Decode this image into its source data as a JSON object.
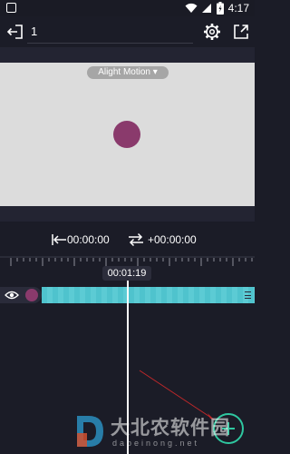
{
  "status_bar": {
    "time": "4:17"
  },
  "toolbar": {
    "project_name": "1"
  },
  "preview": {
    "watermark_label": "Alight Motion ▾",
    "dot_color": "#8a3a6c"
  },
  "timing": {
    "in_time": "00:00:00",
    "out_time": "+00:00:00",
    "current_time": "00:01:19"
  },
  "colors": {
    "accent": "#2fc7a0",
    "track": "#4fc3cd",
    "background": "#1b1c27"
  },
  "watermark": {
    "brand": "大北农软件园",
    "domain": "dabeinong.net"
  },
  "icons": [
    "back-icon",
    "settings-gear-icon",
    "export-icon",
    "jump-to-start-icon",
    "swap-icon",
    "eye-icon",
    "grip-icon",
    "plus-icon"
  ]
}
